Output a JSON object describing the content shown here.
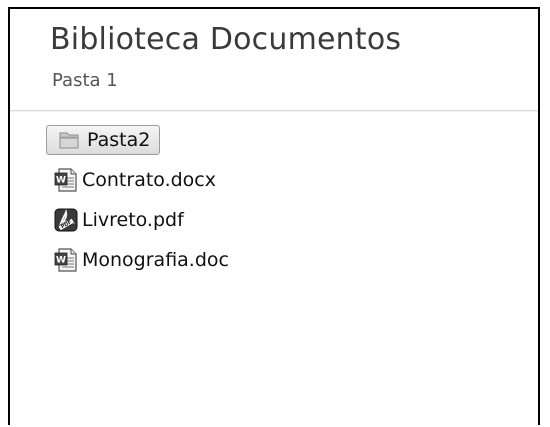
{
  "library": {
    "title": "Biblioteca Documentos",
    "subtitle": "Pasta 1"
  },
  "items": [
    {
      "label": "Pasta2",
      "icon": "folder-icon",
      "selected": true
    },
    {
      "label": "Contrato.docx",
      "icon": "word-document-icon"
    },
    {
      "label": "Livreto.pdf",
      "icon": "pdf-document-icon"
    },
    {
      "label": "Monografia.doc",
      "icon": "word-document-icon"
    }
  ]
}
